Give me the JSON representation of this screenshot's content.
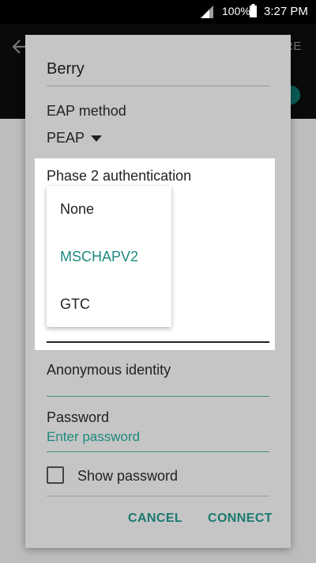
{
  "status_bar": {
    "battery_pct": "100%",
    "time": "3:27 PM",
    "icons": [
      "signal-icon",
      "battery-icon"
    ]
  },
  "app_bar": {
    "more_label": "RE",
    "icons": [
      "back-arrow-icon"
    ]
  },
  "dialog": {
    "title": "Berry",
    "eap_method_label": "EAP method",
    "eap_method_value": "PEAP",
    "phase2_label": "Phase 2 authentication",
    "phase2_options": [
      "None",
      "MSCHAPV2",
      "GTC"
    ],
    "phase2_selected": "MSCHAPV2",
    "anonymous_identity_label": "Anonymous identity",
    "password_label": "Password",
    "password_placeholder": "Enter password",
    "show_password_label": "Show password",
    "show_password_checked": false,
    "cancel_label": "CANCEL",
    "connect_label": "CONNECT"
  },
  "colors": {
    "accent": "#1d8a80",
    "dim_background": "#bdbdbd"
  }
}
